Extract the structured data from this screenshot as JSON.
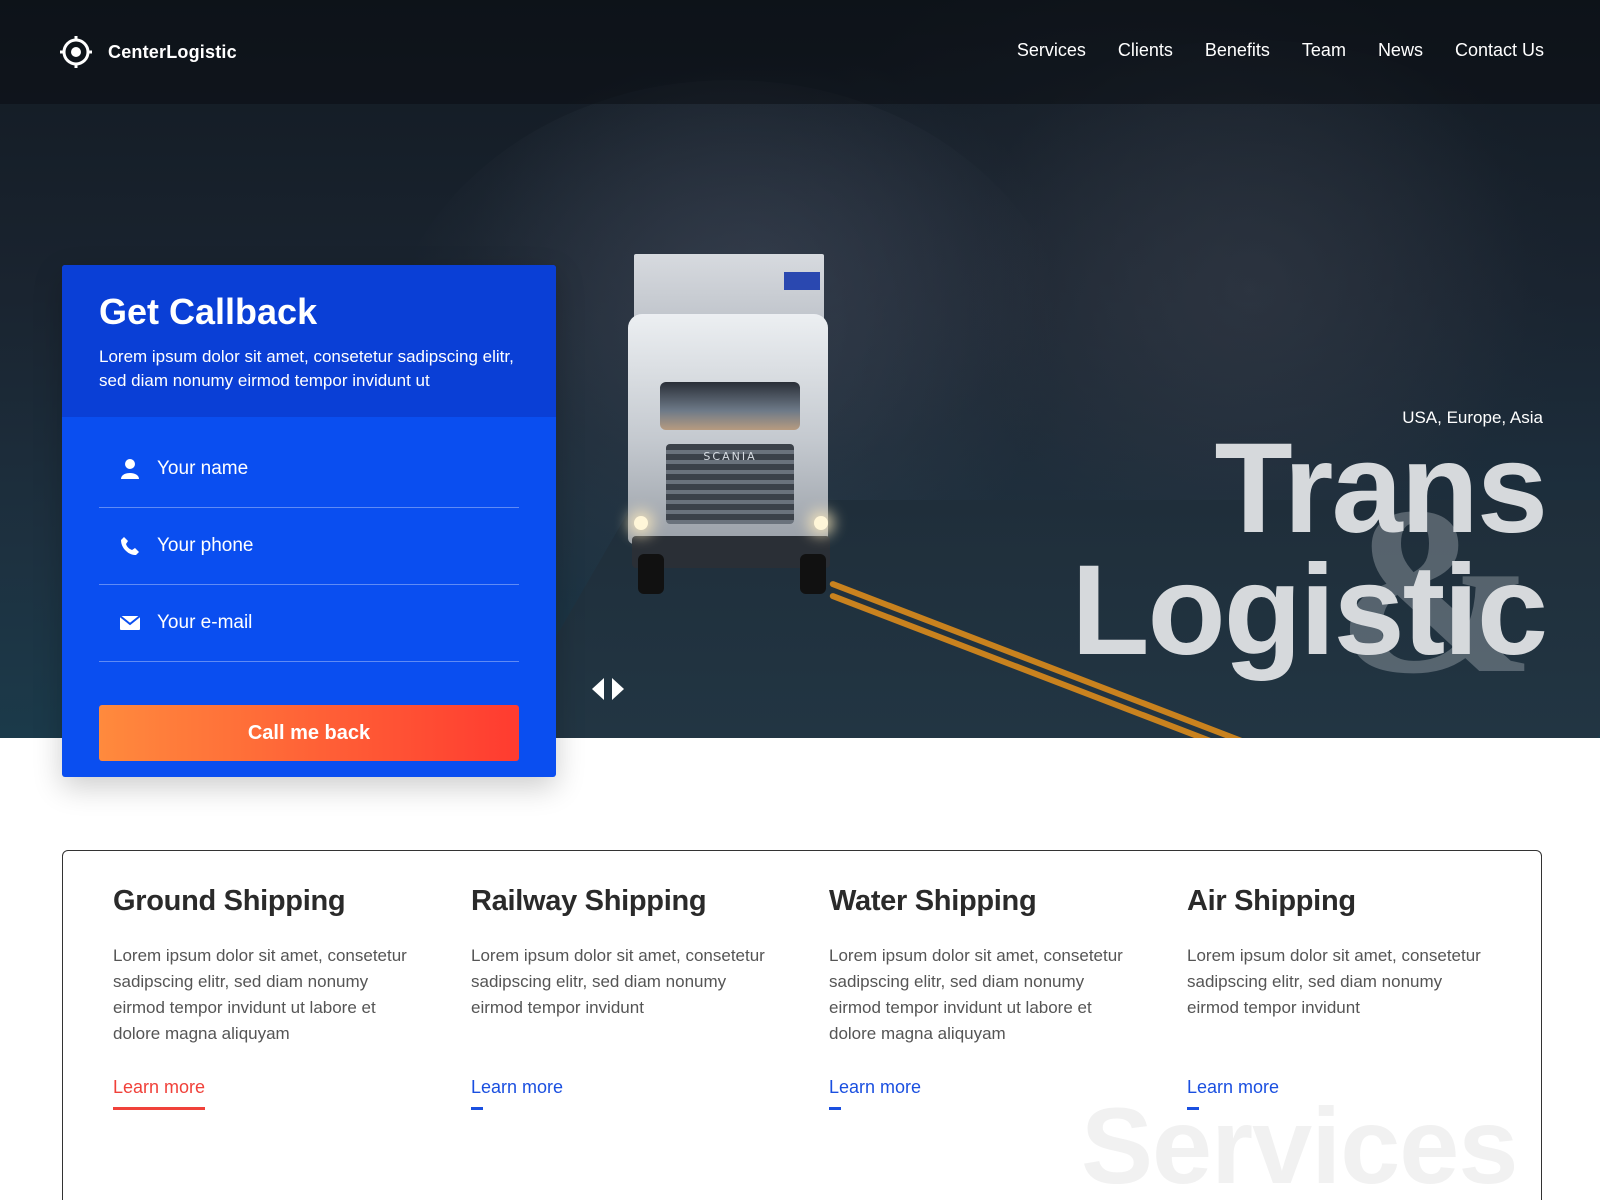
{
  "brand": {
    "name": "CenterLogistic",
    "icon": "crosshair-logo-icon"
  },
  "nav": [
    "Services",
    "Clients",
    "Benefits",
    "Team",
    "News",
    "Contact Us"
  ],
  "hero": {
    "regions": "USA, Europe, Asia",
    "title_line1": "Trans",
    "title_line2": "Logistic",
    "ampersand": "&",
    "truck_brand": "SCANIA"
  },
  "callback": {
    "title": "Get Callback",
    "description": "Lorem ipsum dolor sit amet, consetetur sadipscing elitr, sed diam nonumy eirmod tempor invidunt ut",
    "fields": [
      {
        "placeholder": "Your name",
        "icon": "user-icon"
      },
      {
        "placeholder": "Your phone",
        "icon": "phone-icon"
      },
      {
        "placeholder": "Your e-mail",
        "icon": "envelope-icon"
      }
    ],
    "button": "Call me back"
  },
  "services": {
    "background_word": "Services",
    "items": [
      {
        "title": "Ground Shipping",
        "text": "Lorem ipsum dolor sit amet, consetetur sadipscing elitr, sed diam nonumy eirmod tempor invidunt ut labore et dolore magna aliquyam",
        "link": "Learn more"
      },
      {
        "title": "Railway Shipping",
        "text": "Lorem ipsum dolor sit amet, consetetur sadipscing elitr, sed diam nonumy eirmod tempor invidunt",
        "link": "Learn more"
      },
      {
        "title": "Water Shipping",
        "text": "Lorem ipsum dolor sit amet, consetetur sadipscing elitr, sed diam nonumy eirmod tempor invidunt ut labore et dolore magna aliquyam",
        "link": "Learn more"
      },
      {
        "title": "Air Shipping",
        "text": "Lorem ipsum dolor sit amet, consetetur sadipscing elitr, sed diam nonumy eirmod tempor invidunt",
        "link": "Learn more"
      }
    ]
  },
  "colors": {
    "primary_blue": "#0a4ef0",
    "header_blue": "#0a3fd6",
    "cta_gradient_start": "#ff8a3d",
    "cta_gradient_end": "#ff3b30",
    "link_blue": "#1a4fe0",
    "link_active_red": "#f0413a"
  }
}
